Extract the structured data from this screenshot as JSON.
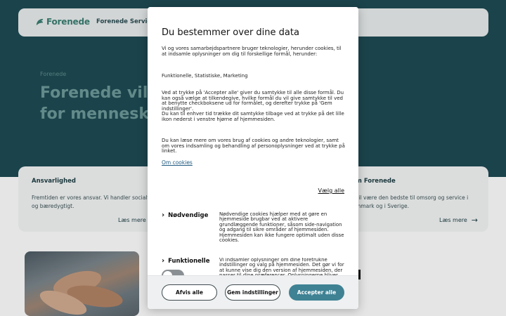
{
  "site": {
    "logo_text": "Forenede",
    "nav_link": "Forenede Service",
    "eyebrow": "Forenede",
    "hero_title_line1": "Forenede vil ge",
    "hero_title_line2": "for mennesker, ",
    "card_left": {
      "title": "Ansvarlighed",
      "text": "Fremtiden er vores ansvar. Vi handler socialt og bæredygtigt.",
      "link": "Læs mere"
    },
    "card_right": {
      "title": "m Forenede",
      "text": "vil være den bedste til omsorg og service i mmark og i Sverige.",
      "link": "Læs mere"
    }
  },
  "consent": {
    "title": "Du bestemmer over dine data",
    "intro": "Vi og vores samarbejdspartnere bruger teknologier, herunder cookies, til at indsamle oplysninger om dig til forskellige formål, herunder:",
    "purposes": "Funktionelle, Statistiske, Marketing",
    "consent_text": "Ved at trykke på 'Accepter alle' giver du samtykke til alle disse formål. Du kan også vælge at tilkendegive, hvilke formål du vil give samtykke til ved at benytte checkboksene ud for formålet, og derefter trykke på 'Gem indstillinger'.",
    "withdraw_text": "Du kan til enhver tid trække dit samtykke tilbage ved at trykke på det lille ikon nederst i venstre hjørne af hjemmesiden.",
    "more_text": "Du kan læse mere om vores brug af cookies og andre teknologier, samt om vores indsamling og behandling af personoplysninger ved at trykke på linket.",
    "cookie_link": "Om cookies",
    "select_all": "Vælg alle",
    "categories": [
      {
        "name": "Nødvendige",
        "description": "Nødvendige cookies hjælper med at gøre en hjemmeside brugbar ved at aktivere grundlæggende funktioner, såsom side-navigation og adgang til sikre områder af hjemmesiden. Hjemmesiden kan ikke fungere optimalt uden disse cookies."
      },
      {
        "name": "Funktionelle",
        "description": "Vi indsamler oplysninger om dine foretrukne indstillinger og valg på hjemmesiden. Det gør vi for at kunne vise dig den version af hjemmesiden, der passer til dine præferencer. Oplysningerne bliver brugt til at afgøre, hvilken version og sprog du",
        "enabled": false
      }
    ],
    "buttons": {
      "reject": "Afvis alle",
      "save": "Gem indstillinger",
      "accept": "Accepter alle"
    }
  },
  "colors": {
    "hero_bg": "#1f4b54",
    "accent": "#3e8294",
    "logo": "#3b7f73",
    "link": "#1f5a80"
  }
}
